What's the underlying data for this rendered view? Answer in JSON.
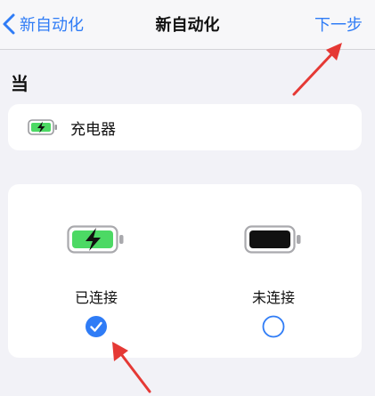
{
  "nav": {
    "back_label": "新自动化",
    "title": "新自动化",
    "next_label": "下一步"
  },
  "section_label": "当",
  "trigger": {
    "label": "充电器",
    "icon": "charging-battery-icon"
  },
  "options": [
    {
      "label": "已连接",
      "icon": "charging-battery-icon",
      "selected": true
    },
    {
      "label": "未连接",
      "icon": "full-battery-icon",
      "selected": false
    }
  ],
  "colors": {
    "accent": "#2f7cf6",
    "background": "#f2f2f7",
    "card": "#ffffff",
    "battery_green": "#4cd964",
    "annotation_arrow": "#e53935"
  }
}
